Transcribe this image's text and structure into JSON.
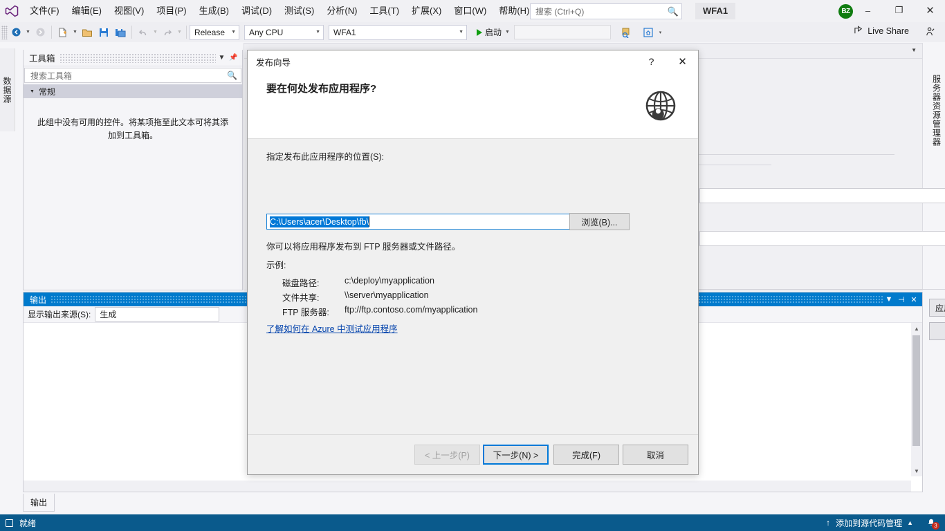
{
  "app": {
    "menu": [
      "文件(F)",
      "编辑(E)",
      "视图(V)",
      "项目(P)",
      "生成(B)",
      "调试(D)",
      "测试(S)",
      "分析(N)",
      "工具(T)",
      "扩展(X)",
      "窗口(W)",
      "帮助(H)"
    ],
    "quick_search_placeholder": "搜索 (Ctrl+Q)",
    "solution_name": "WFA1",
    "avatar_initials": "BZ",
    "window_buttons": {
      "minimize": "–",
      "maximize": "❐",
      "close": "✕"
    }
  },
  "toolbar": {
    "configuration": "Release",
    "platform": "Any CPU",
    "startup_project": "WFA1",
    "run_label": "启动",
    "live_share": "Live Share"
  },
  "docks": {
    "left_vertical_tab": "数据源",
    "right_vertical_tab": "服务器资源管理器"
  },
  "toolbox": {
    "title": "工具箱",
    "search_placeholder": "搜索工具箱",
    "group": "常规",
    "empty_message": "此组中没有可用的控件。将某项拖至此文本可将其添加到工具箱。"
  },
  "background_page": {
    "app_files_button": "应用程序文件(I)..."
  },
  "output": {
    "title": "输出",
    "source_label": "显示输出来源(S):",
    "source_value": "生成",
    "tab_label": "输出"
  },
  "status_bar": {
    "ready": "就绪",
    "source_control": "添加到源代码管理",
    "notification_count": "3"
  },
  "dialog": {
    "title": "发布向导",
    "help_glyph": "?",
    "close_glyph": "✕",
    "heading": "要在何处发布应用程序?",
    "location_label": "指定发布此应用程序的位置(S):",
    "location_value": "C:\\Users\\acer\\Desktop\\fb\\",
    "browse_button": "浏览(B)...",
    "hint": "你可以将应用程序发布到 FTP 服务器或文件路径。",
    "examples_title": "示例:",
    "examples": [
      {
        "key": "磁盘路径:",
        "value": "c:\\deploy\\myapplication"
      },
      {
        "key": "文件共享:",
        "value": "\\\\server\\myapplication"
      },
      {
        "key": "FTP 服务器:",
        "value": "ftp://ftp.contoso.com/myapplication"
      }
    ],
    "link": "了解如何在 Azure 中测试应用程序",
    "buttons": {
      "previous": "< 上一步(P)",
      "next": "下一步(N) >",
      "finish": "完成(F)",
      "cancel": "取消"
    }
  },
  "colors": {
    "accent": "#007acc",
    "status_bar": "#0a5a8c",
    "selection": "#0078d7",
    "link": "#0645ad",
    "avatar": "#107c10"
  }
}
